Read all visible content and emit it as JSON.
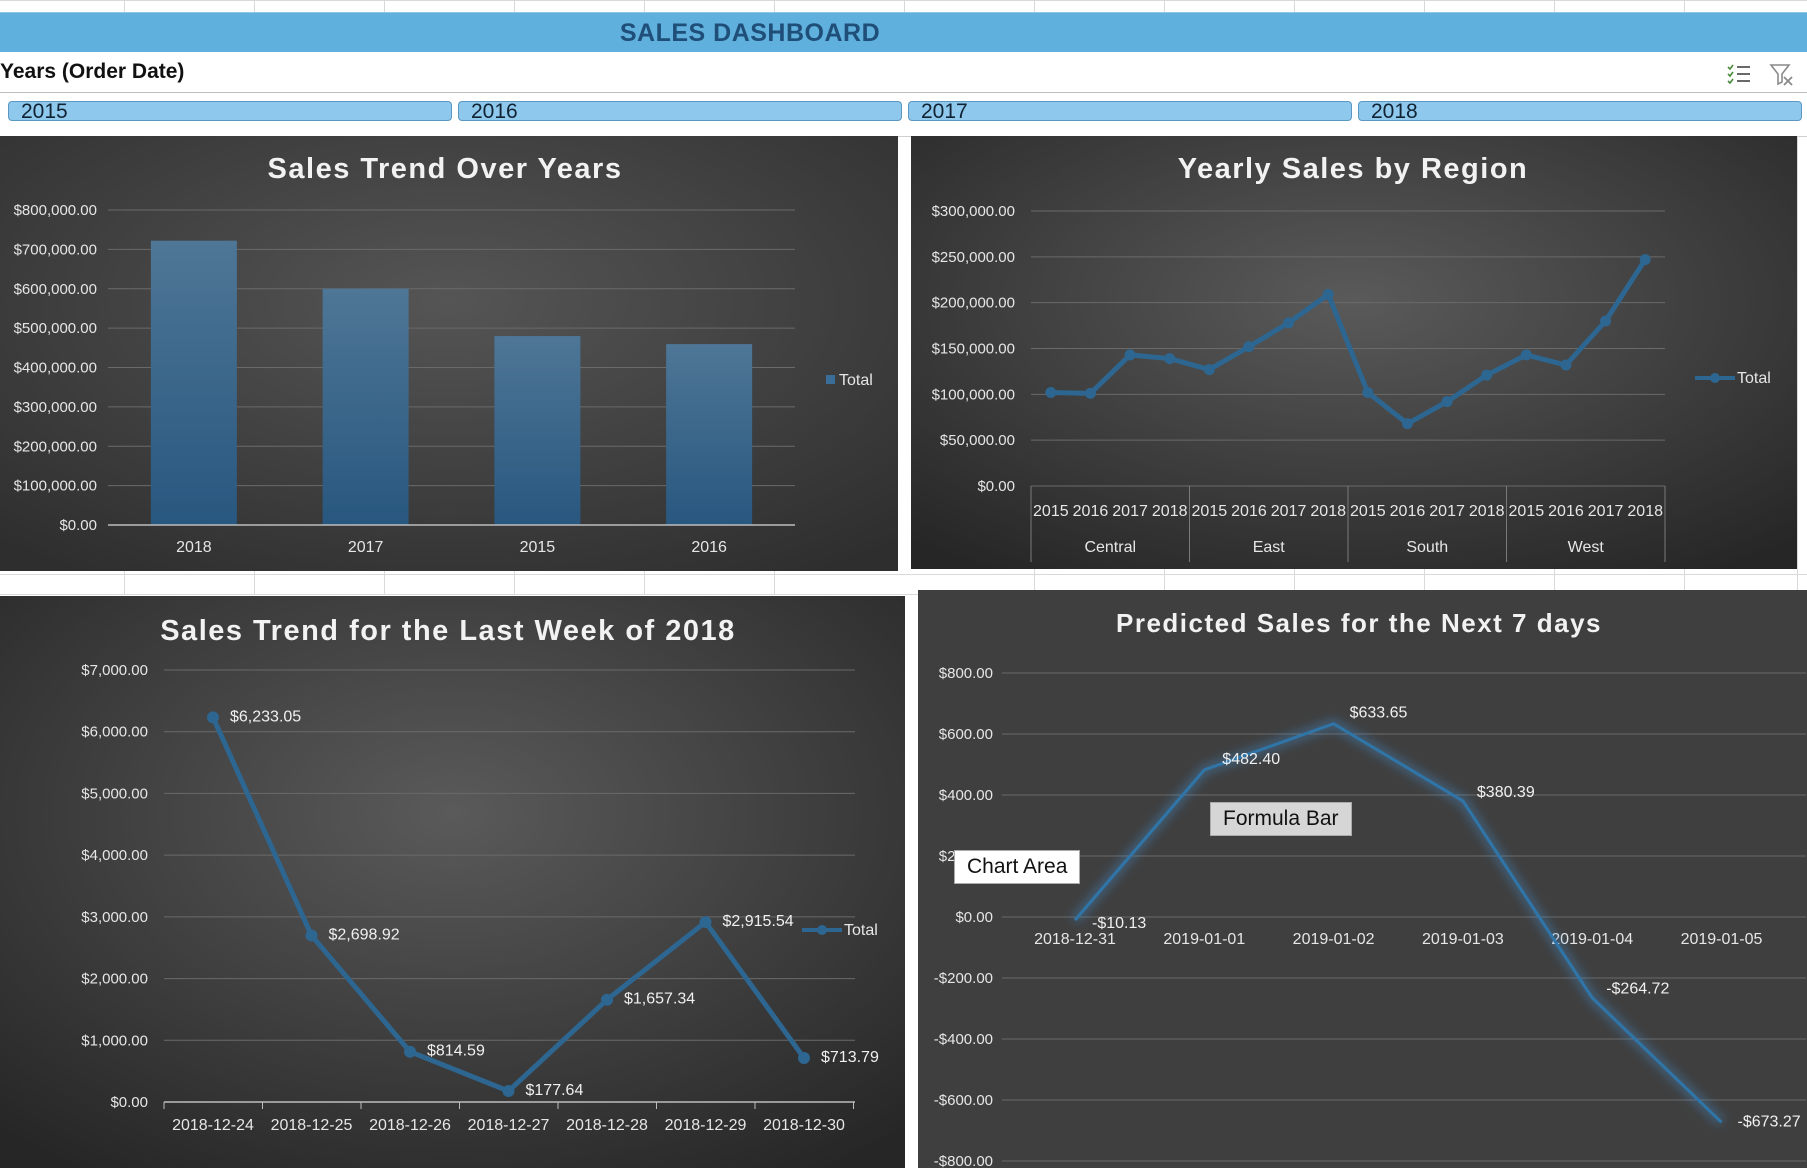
{
  "dashboard": {
    "title": "SALES DASHBOARD"
  },
  "slicer": {
    "header": "Years (Order Date)",
    "items": [
      "2015",
      "2016",
      "2017",
      "2018"
    ],
    "icons": [
      "multi-select-icon",
      "clear-filter-icon"
    ]
  },
  "tooltips": {
    "chart_area": "Chart Area",
    "formula_bar": "Formula Bar"
  },
  "colors": {
    "title_bar": "#5fb0dc",
    "slicer_item": "#8ec8ec",
    "series": "#2d6690",
    "panel_bg": "#404040",
    "predict_line": "#2f75a8"
  },
  "chart_data": [
    {
      "type": "bar",
      "title": "Sales Trend Over Years",
      "categories": [
        "2018",
        "2017",
        "2015",
        "2016"
      ],
      "series": [
        {
          "name": "Total",
          "values": [
            722052.02,
            600192.55,
            479856.21,
            459436.01
          ]
        }
      ],
      "ylim": [
        0,
        800000
      ],
      "yticks": [
        "$0.00",
        "$100,000.00",
        "$200,000.00",
        "$300,000.00",
        "$400,000.00",
        "$500,000.00",
        "$600,000.00",
        "$700,000.00",
        "$800,000.00"
      ],
      "legend": "right",
      "grid": true
    },
    {
      "type": "line",
      "title": "Yearly Sales by Region",
      "categories": [
        "2015",
        "2016",
        "2017",
        "2018",
        "2015",
        "2016",
        "2017",
        "2018",
        "2015",
        "2016",
        "2017",
        "2018",
        "2015",
        "2016",
        "2017",
        "2018"
      ],
      "groups": [
        "Central",
        "East",
        "South",
        "West"
      ],
      "series": [
        {
          "name": "Total",
          "values": [
            102000,
            101000,
            143000,
            139000,
            127000,
            152000,
            178000,
            209000,
            102000,
            68000,
            92000,
            121000,
            143000,
            132000,
            180000,
            247000
          ]
        }
      ],
      "ylim": [
        0,
        300000
      ],
      "yticks": [
        "$0.00",
        "$50,000.00",
        "$100,000.00",
        "$150,000.00",
        "$200,000.00",
        "$250,000.00",
        "$300,000.00"
      ],
      "legend": "right",
      "grid": true
    },
    {
      "type": "line",
      "title": "Sales Trend for the Last Week of 2018",
      "categories": [
        "2018-12-24",
        "2018-12-25",
        "2018-12-26",
        "2018-12-27",
        "2018-12-28",
        "2018-12-29",
        "2018-12-30"
      ],
      "series": [
        {
          "name": "Total",
          "values": [
            6233.05,
            2698.92,
            814.59,
            177.64,
            1657.34,
            2915.54,
            713.79
          ]
        }
      ],
      "labels": [
        "$6,233.05",
        "$2,698.92",
        "$814.59",
        "$177.64",
        "$1,657.34",
        "$2,915.54",
        "$713.79"
      ],
      "ylim": [
        0,
        7000
      ],
      "yticks": [
        "$0.00",
        "$1,000.00",
        "$2,000.00",
        "$3,000.00",
        "$4,000.00",
        "$5,000.00",
        "$6,000.00",
        "$7,000.00"
      ],
      "legend": "right",
      "grid": true
    },
    {
      "type": "line",
      "title": "Predicted Sales for the Next 7 days",
      "categories": [
        "2018-12-31",
        "2019-01-01",
        "2019-01-02",
        "2019-01-03",
        "2019-01-04",
        "2019-01-05"
      ],
      "series": [
        {
          "values": [
            -10.13,
            482.4,
            633.65,
            380.39,
            -264.72,
            -673.27
          ]
        }
      ],
      "labels": [
        "-$10.13",
        "$482.40",
        "$633.65",
        "$380.39",
        "-$264.72",
        "-$673.27"
      ],
      "ylim": [
        -800,
        800
      ],
      "yticks": [
        "-$800.00",
        "-$600.00",
        "-$400.00",
        "-$200.00",
        "$0.00",
        "$200.00",
        "$400.00",
        "$600.00",
        "$800.00"
      ],
      "grid": true
    }
  ]
}
